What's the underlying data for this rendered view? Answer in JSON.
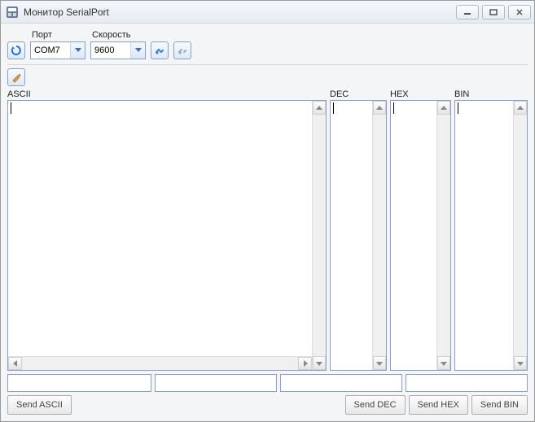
{
  "window": {
    "title": "Монитор SerialPort"
  },
  "toolbar": {
    "port_label": "Порт",
    "port_value": "COM7",
    "speed_label": "Скорость",
    "speed_value": "9600"
  },
  "columns": {
    "ascii_label": "ASCII",
    "dec_label": "DEC",
    "hex_label": "HEX",
    "bin_label": "BIN"
  },
  "buttons": {
    "send_ascii": "Send ASCII",
    "send_dec": "Send DEC",
    "send_hex": "Send HEX",
    "send_bin": "Send BIN"
  },
  "inputs": {
    "ascii_value": "",
    "dec_value": "",
    "hex_value": "",
    "bin_value": ""
  }
}
